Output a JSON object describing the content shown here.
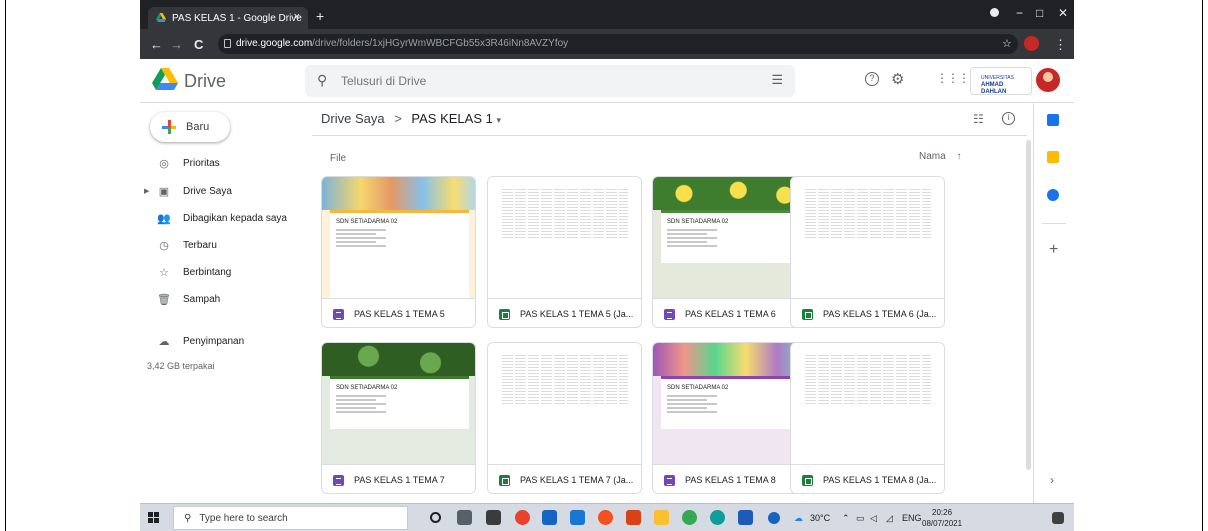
{
  "browser": {
    "tab_title": "PAS KELAS 1 - Google Drive",
    "tab_close": "×",
    "new_tab": "+",
    "url_host": "drive.google.com",
    "url_path": "/drive/folders/1xjHGyrWmWBCFGb55x3R46iNn8AVZYfoy",
    "window_controls": {
      "minimize": "−",
      "maximize": "□",
      "close": "✕"
    }
  },
  "header": {
    "brand": "Drive",
    "search_placeholder": "Telusuri di Drive",
    "org_logo_line1": "UNIVERSITAS",
    "org_logo_line2": "AHMAD DAHLAN"
  },
  "sidebar": {
    "new_label": "Baru",
    "items": [
      {
        "label": "Prioritas",
        "icon": "check-circle-icon"
      },
      {
        "label": "Drive Saya",
        "icon": "my-drive-icon"
      },
      {
        "label": "Dibagikan kepada saya",
        "icon": "shared-icon"
      },
      {
        "label": "Terbaru",
        "icon": "clock-icon"
      },
      {
        "label": "Berbintang",
        "icon": "star-icon"
      },
      {
        "label": "Sampah",
        "icon": "trash-icon"
      }
    ],
    "storage_label": "Penyimpanan",
    "storage_used": "3,42 GB terpakai"
  },
  "main": {
    "breadcrumb_root": "Drive Saya",
    "breadcrumb_sep": ">",
    "breadcrumb_current": "PAS KELAS 1",
    "section_label": "File",
    "sort_label": "Nama",
    "files": [
      {
        "name": "PAS KELAS 1 TEMA 5",
        "type": "form",
        "thumb": "form-eggs"
      },
      {
        "name": "PAS KELAS 1 TEMA 5 (Ja...",
        "type": "sheet",
        "thumb": "sheet"
      },
      {
        "name": "PAS KELAS 1 TEMA 6",
        "type": "form",
        "thumb": "form-lemons"
      },
      {
        "name": "PAS KELAS 1 TEMA 6 (Ja...",
        "type": "sheet",
        "thumb": "sheet"
      },
      {
        "name": "PAS KELAS 1 TEMA 7",
        "type": "form",
        "thumb": "form-clover"
      },
      {
        "name": "PAS KELAS 1 TEMA 7 (Ja...",
        "type": "sheet",
        "thumb": "sheet"
      },
      {
        "name": "PAS KELAS 1 TEMA 8",
        "type": "form",
        "thumb": "form-plants"
      },
      {
        "name": "PAS KELAS 1 TEMA 8 (Ja...",
        "type": "sheet",
        "thumb": "sheet"
      }
    ],
    "form_school_name": "SDN SETIADARMA 02"
  },
  "taskbar": {
    "search_placeholder": "Type here to search",
    "temperature": "30°C",
    "language": "ENG",
    "time": "20:26",
    "date": "08/07/2021"
  },
  "colors": {
    "tabstrip": "#202124",
    "toolbar": "#35363a",
    "form_purple": "#7248b9",
    "sheet_green": "#188038",
    "taskbar": "#d6dbe3"
  }
}
